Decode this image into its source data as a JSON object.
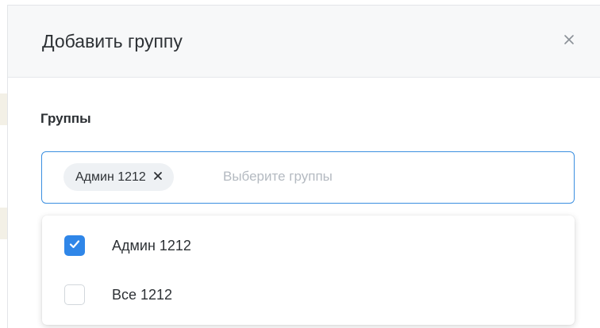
{
  "modal": {
    "title": "Добавить группу",
    "close_icon": "close-icon"
  },
  "field": {
    "label": "Группы",
    "placeholder": "Выберите группы",
    "selected_tags": [
      {
        "label": "Админ 1212",
        "remove_icon": "close-icon"
      }
    ]
  },
  "dropdown": {
    "options": [
      {
        "label": "Админ 1212",
        "checked": true
      },
      {
        "label": "Все 1212",
        "checked": false
      }
    ]
  },
  "colors": {
    "accent": "#2f86e8",
    "focus_border": "#3b8fe0",
    "tag_bg": "#eef1f4",
    "header_bg": "#f7f8f9"
  }
}
